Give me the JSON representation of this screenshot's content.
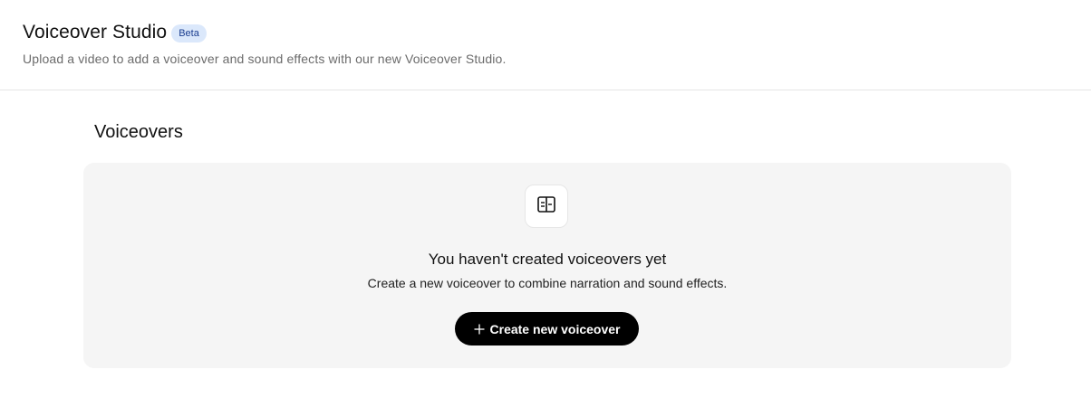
{
  "header": {
    "title": "Voiceover Studio",
    "badge": "Beta",
    "subtitle": "Upload a video to add a voiceover and sound effects with our new Voiceover Studio."
  },
  "section": {
    "title": "Voiceovers"
  },
  "empty_state": {
    "icon": "voiceover-layout-icon",
    "heading": "You haven't created voiceovers yet",
    "description": "Create a new voiceover to combine narration and sound effects.",
    "button_icon": "plus-icon",
    "button_label": "Create new voiceover"
  },
  "colors": {
    "badge_bg": "#dbe8fb",
    "badge_text": "#1a3d8f",
    "card_bg": "#f5f5f5",
    "button_bg": "#000000",
    "button_text": "#ffffff"
  }
}
